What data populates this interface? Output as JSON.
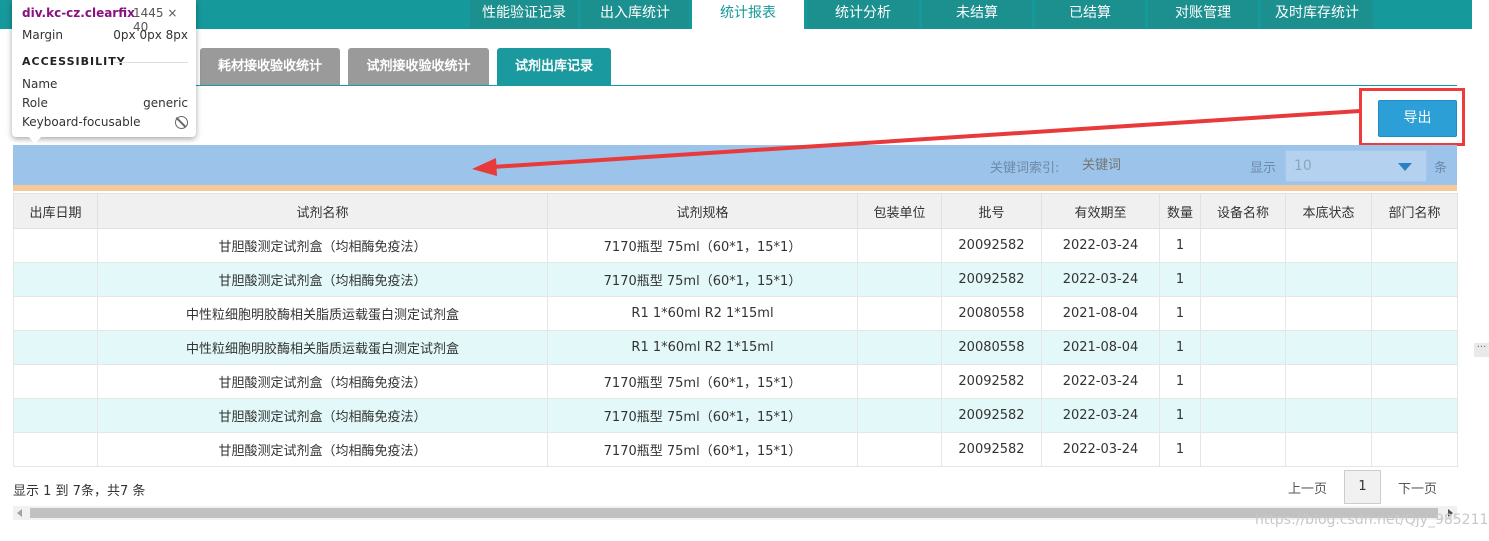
{
  "nav": {
    "tabs": [
      {
        "label": "性能验证记录"
      },
      {
        "label": "出入库统计"
      },
      {
        "label": "统计报表",
        "active": true
      },
      {
        "label": "统计分析"
      },
      {
        "label": "未结算"
      },
      {
        "label": "已结算"
      },
      {
        "label": "对账管理"
      },
      {
        "label": "及时库存统计"
      }
    ]
  },
  "subtabs": [
    {
      "label": "耗材接收验收统计"
    },
    {
      "label": "试剂接收验收统计"
    },
    {
      "label": "试剂出库记录",
      "active": true
    }
  ],
  "toolbar": {
    "export_label": "导出",
    "keyword_label": "关键词索引:",
    "keyword_placeholder": "关键词",
    "show_label": "显示",
    "page_size": "10",
    "unit_label": "条"
  },
  "table": {
    "headers": [
      "出库日期",
      "试剂名称",
      "试剂规格",
      "包装单位",
      "批号",
      "有效期至",
      "数量",
      "设备名称",
      "本底状态",
      "部门名称"
    ],
    "rows": [
      [
        "",
        "甘胆酸测定试剂盒（均相酶免疫法）",
        "7170瓶型 75ml（60*1，15*1）",
        "",
        "20092582",
        "2022-03-24",
        "1",
        "",
        "",
        ""
      ],
      [
        "",
        "甘胆酸测定试剂盒（均相酶免疫法）",
        "7170瓶型 75ml（60*1，15*1）",
        "",
        "20092582",
        "2022-03-24",
        "1",
        "",
        "",
        ""
      ],
      [
        "",
        "中性粒细胞明胶酶相关脂质运载蛋白测定试剂盒",
        "R1 1*60ml R2 1*15ml",
        "",
        "20080558",
        "2021-08-04",
        "1",
        "",
        "",
        ""
      ],
      [
        "",
        "中性粒细胞明胶酶相关脂质运载蛋白测定试剂盒",
        "R1 1*60ml R2 1*15ml",
        "",
        "20080558",
        "2021-08-04",
        "1",
        "",
        "",
        ""
      ],
      [
        "",
        "甘胆酸测定试剂盒（均相酶免疫法）",
        "7170瓶型 75ml（60*1，15*1）",
        "",
        "20092582",
        "2022-03-24",
        "1",
        "",
        "",
        ""
      ],
      [
        "",
        "甘胆酸测定试剂盒（均相酶免疫法）",
        "7170瓶型 75ml（60*1，15*1）",
        "",
        "20092582",
        "2022-03-24",
        "1",
        "",
        "",
        ""
      ],
      [
        "",
        "甘胆酸测定试剂盒（均相酶免疫法）",
        "7170瓶型 75ml（60*1，15*1）",
        "",
        "20092582",
        "2022-03-24",
        "1",
        "",
        "",
        ""
      ]
    ]
  },
  "footer": {
    "summary": "显示 1 到 7条，共7 条",
    "prev_label": "上一页",
    "current_page": "1",
    "next_label": "下一页"
  },
  "watermark": "https://blog.csdn.net/Qjy_985211",
  "devtools_tooltip": {
    "selector": "div.kc-cz.clearfix",
    "size": "1445 × 40",
    "margin_label": "Margin",
    "margin_value": "0px 0px 8px",
    "section_title": "ACCESSIBILITY",
    "name_label": "Name",
    "name_value": "",
    "role_label": "Role",
    "role_value": "generic",
    "focus_label": "Keyboard-focusable"
  },
  "colors": {
    "nav_bg": "#16999a",
    "subtab_active": "#1a9a9f",
    "export_button": "#2c9fd6",
    "highlight": "#ee3b3b",
    "toolbar_band": "#9cc3ea",
    "alt_row": "#e3f8f8"
  },
  "icons": {
    "select_caret": "chevron-down-icon",
    "not_focusable": "prohibited-icon",
    "pointer_arrow": "red-arrow-annotation"
  }
}
